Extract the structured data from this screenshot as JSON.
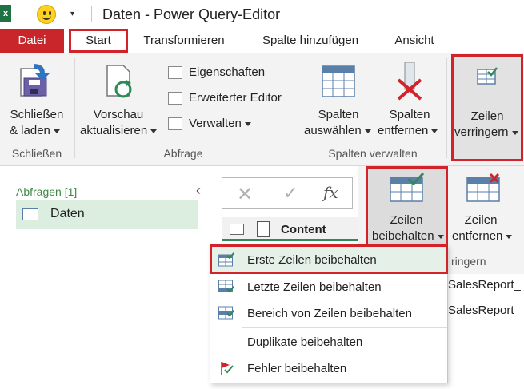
{
  "window": {
    "app_icon_letter": "x",
    "title": "Daten - Power Query-Editor"
  },
  "ribbon_tabs": [
    "Datei",
    "Start",
    "Transformieren",
    "Spalte hinzufügen",
    "Ansicht"
  ],
  "ribbon": {
    "close_load": {
      "line1": "Schließen",
      "line2": "& laden"
    },
    "refresh": {
      "line1": "Vorschau",
      "line2": "aktualisieren"
    },
    "properties": "Eigenschaften",
    "advanced_editor": "Erweiterter Editor",
    "manage": "Verwalten",
    "choose_columns": {
      "line1": "Spalten",
      "line2": "auswählen"
    },
    "remove_columns": {
      "line1": "Spalten",
      "line2": "entfernen"
    },
    "reduce_rows": {
      "line1": "Zeilen",
      "line2": "verringern"
    },
    "groups": {
      "close": "Schließen",
      "query": "Abfrage",
      "manage_columns": "Spalten verwalten"
    }
  },
  "queries_pane": {
    "title": "Abfragen [1]",
    "items": [
      "Daten"
    ]
  },
  "grid": {
    "column_header": "Content",
    "cells": [
      "SalesReport_",
      "SalesReport_"
    ]
  },
  "sub_ribbon": {
    "keep_rows": {
      "line1": "Zeilen",
      "line2": "beibehalten"
    },
    "remove_rows": {
      "line1": "Zeilen",
      "line2": "entfernen"
    },
    "group_label_partial": "ringern"
  },
  "keep_rows_menu": {
    "items": [
      "Erste Zeilen beibehalten",
      "Letzte Zeilen beibehalten",
      "Bereich von Zeilen beibehalten",
      "Duplikate beibehalten",
      "Fehler beibehalten"
    ]
  },
  "colors": {
    "excel_green": "#1f7244",
    "file_tab_red": "#c8262b",
    "highlight_red": "#d2232a",
    "query_selected": "#dbeee0",
    "ribbon_bg": "#f3f3f3"
  }
}
